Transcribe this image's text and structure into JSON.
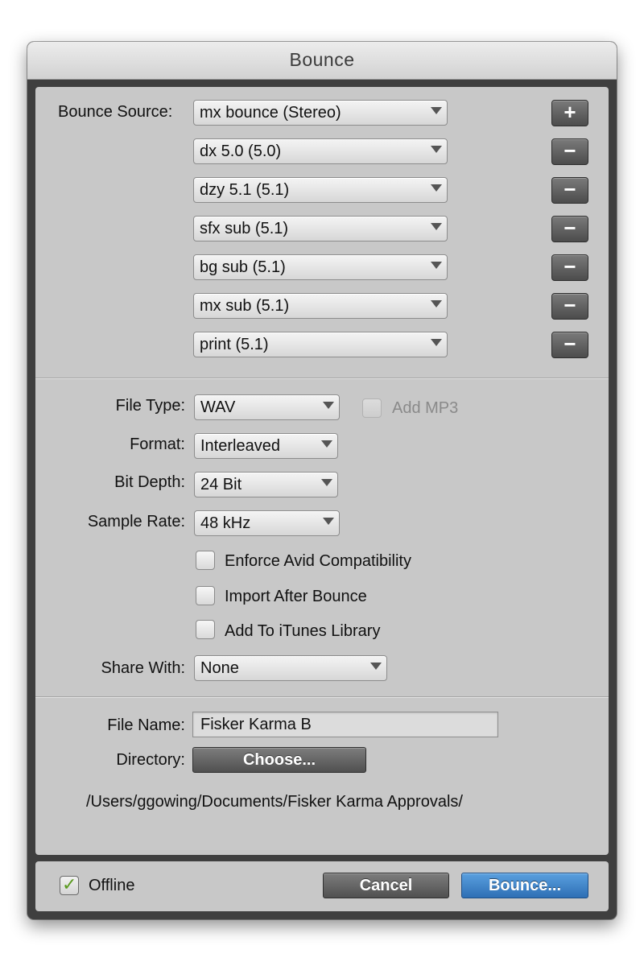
{
  "window": {
    "title": "Bounce"
  },
  "bounce_source": {
    "label": "Bounce Source:",
    "sources": [
      {
        "value": "mx bounce (Stereo)",
        "button": "+"
      },
      {
        "value": "dx 5.0 (5.0)",
        "button": "−"
      },
      {
        "value": "dzy 5.1 (5.1)",
        "button": "−"
      },
      {
        "value": "sfx sub (5.1)",
        "button": "−"
      },
      {
        "value": "bg sub (5.1)",
        "button": "−"
      },
      {
        "value": "mx sub (5.1)",
        "button": "−"
      },
      {
        "value": "print (5.1)",
        "button": "−"
      }
    ]
  },
  "file_settings": {
    "file_type": {
      "label": "File Type:",
      "value": "WAV"
    },
    "add_mp3": {
      "label": "Add MP3",
      "checked": false,
      "enabled": false
    },
    "format": {
      "label": "Format:",
      "value": "Interleaved"
    },
    "bit_depth": {
      "label": "Bit Depth:",
      "value": "24 Bit"
    },
    "sample_rate": {
      "label": "Sample Rate:",
      "value": "48 kHz"
    },
    "enforce_avid": {
      "label": "Enforce Avid Compatibility",
      "checked": false
    },
    "import_after": {
      "label": "Import After Bounce",
      "checked": false
    },
    "add_itunes": {
      "label": "Add To iTunes Library",
      "checked": false
    },
    "share_with": {
      "label": "Share With:",
      "value": "None"
    }
  },
  "output": {
    "file_name": {
      "label": "File Name:",
      "value": "Fisker Karma B"
    },
    "directory": {
      "label": "Directory:",
      "button": "Choose..."
    },
    "path": "/Users/ggowing/Documents/Fisker Karma Approvals/"
  },
  "footer": {
    "offline": {
      "label": "Offline",
      "checked": true
    },
    "cancel": "Cancel",
    "bounce": "Bounce..."
  },
  "colors": {
    "panel": "#c8c8c8",
    "frame": "#3f3f3f",
    "primary_button": "#3f86cc",
    "checkmark": "#5a9a1f"
  }
}
